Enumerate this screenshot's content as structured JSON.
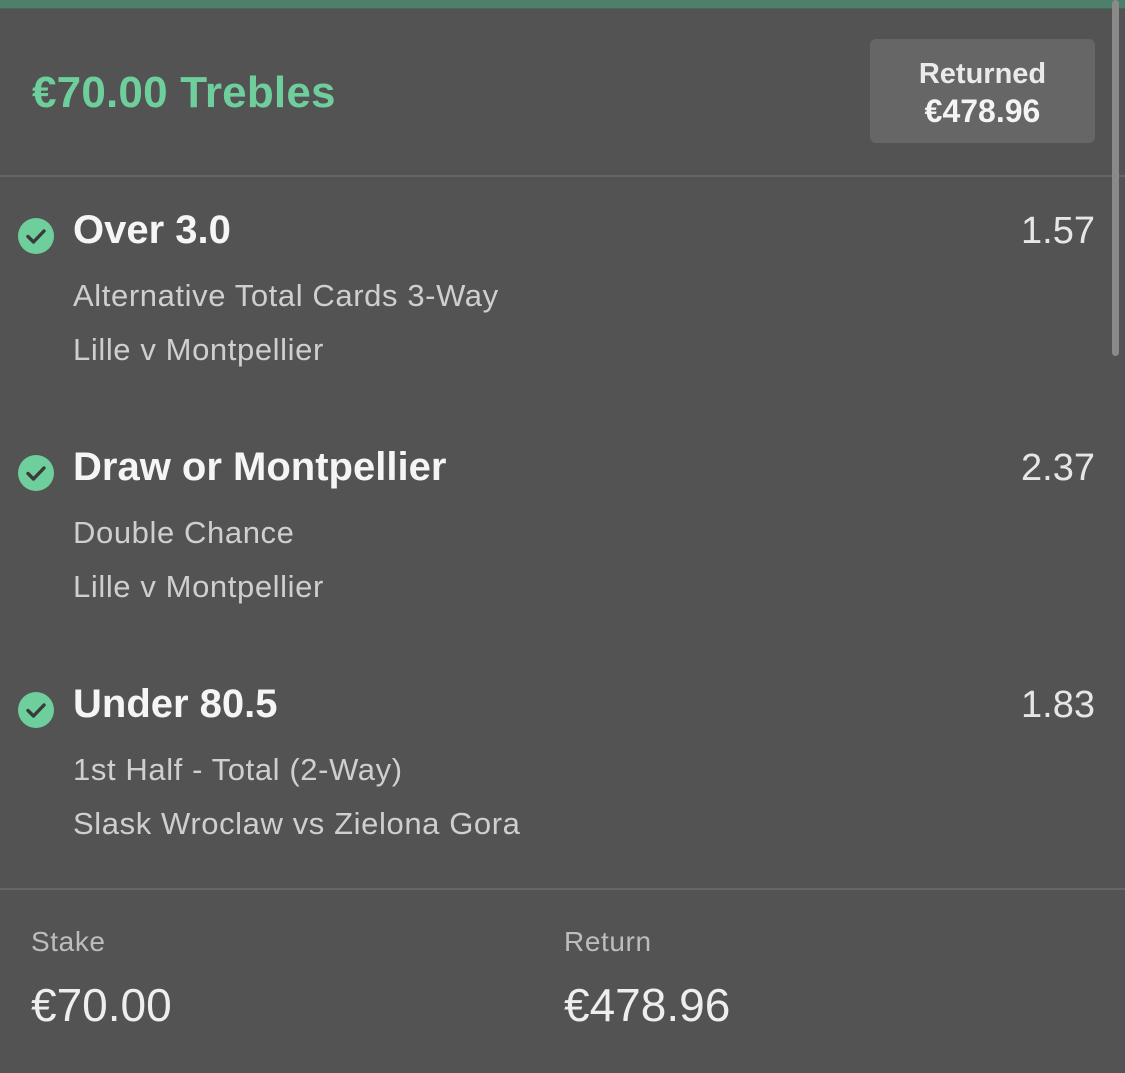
{
  "bet": {
    "title": "€70.00 Trebles",
    "returned_label": "Returned",
    "returned_amount": "€478.96"
  },
  "selections": [
    {
      "name": "Over 3.0",
      "odds": "1.57",
      "market": "Alternative Total Cards 3-Way",
      "event": "Lille v Montpellier",
      "status_icon": "check-circle-icon"
    },
    {
      "name": "Draw or Montpellier",
      "odds": "2.37",
      "market": "Double Chance",
      "event": "Lille v Montpellier",
      "status_icon": "check-circle-icon"
    },
    {
      "name": "Under 80.5",
      "odds": "1.83",
      "market": "1st Half - Total (2-Way)",
      "event": "Slask Wroclaw vs Zielona Gora",
      "status_icon": "check-circle-icon"
    }
  ],
  "footer": {
    "stake_label": "Stake",
    "stake_value": "€70.00",
    "return_label": "Return",
    "return_value": "€478.96"
  },
  "colors": {
    "background": "#535353",
    "accent_green": "#6fcf9c",
    "returned_box": "#666666"
  }
}
